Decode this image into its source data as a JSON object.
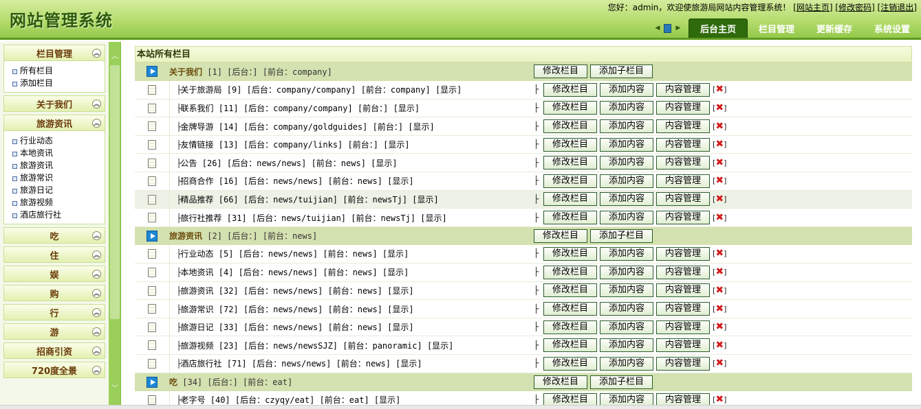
{
  "header": {
    "logo": "网站管理系统",
    "greeting": "您好：admin，欢迎使旅游局网站内容管理系统！",
    "links": [
      "[网站主页]",
      "[修改密码]",
      "[注销退出]"
    ],
    "tabs": [
      "后台主页",
      "栏目管理",
      "更新缓存",
      "系统设置"
    ],
    "active_tab": "后台主页"
  },
  "sidebar": {
    "sections": [
      {
        "title": "栏目管理",
        "items": [
          "所有栏目",
          "添加栏目"
        ]
      },
      {
        "title": "关于我们",
        "items": []
      },
      {
        "title": "旅游资讯",
        "items": [
          "行业动态",
          "本地资讯",
          "旅游资讯",
          "旅游常识",
          "旅游日记",
          "旅游视频",
          "酒店旅行社"
        ]
      },
      {
        "title": "吃",
        "items": []
      },
      {
        "title": "住",
        "items": []
      },
      {
        "title": "娱",
        "items": []
      },
      {
        "title": "购",
        "items": []
      },
      {
        "title": "行",
        "items": []
      },
      {
        "title": "游",
        "items": []
      },
      {
        "title": "招商引资",
        "items": []
      },
      {
        "title": "720度全景",
        "items": []
      }
    ]
  },
  "main": {
    "title": "本站所有栏目",
    "buttons": {
      "edit": "修改栏目",
      "add_child": "添加子栏目",
      "add_content": "添加内容",
      "manage_content": "内容管理",
      "delete_icon": "✖"
    },
    "rows": [
      {
        "type": "parent",
        "name": "关于我们",
        "meta": "[1] [后台：] [前台：company]"
      },
      {
        "type": "child",
        "name": "关于旅游局",
        "meta": "[9] [后台：company/company] [前台：company] [显示]"
      },
      {
        "type": "child",
        "name": "联系我们",
        "meta": "[11] [后台：company/company] [前台：] [显示]"
      },
      {
        "type": "child",
        "name": "金牌导游",
        "meta": "[14] [后台：company/goldguides] [前台：] [显示]"
      },
      {
        "type": "child",
        "name": "友情链接",
        "meta": "[13] [后台：company/links] [前台：] [显示]"
      },
      {
        "type": "child",
        "name": "公告",
        "meta": "[26] [后台：news/news] [前台：news] [显示]"
      },
      {
        "type": "child",
        "name": "招商合作",
        "meta": "[16] [后台：news/news] [前台：news] [显示]"
      },
      {
        "type": "child",
        "name": "精品推荐",
        "meta": "[66] [后台：news/tuijian] [前台：newsTj] [显示]",
        "highlight": true
      },
      {
        "type": "child",
        "name": "旅行社推荐",
        "meta": "[31] [后台：news/tuijian] [前台：newsTj] [显示]"
      },
      {
        "type": "parent",
        "name": "旅游资讯",
        "meta": "[2] [后台：] [前台：news]"
      },
      {
        "type": "child",
        "name": "行业动态",
        "meta": "[5] [后台：news/news] [前台：news] [显示]"
      },
      {
        "type": "child",
        "name": "本地资讯",
        "meta": "[4] [后台：news/news] [前台：news] [显示]"
      },
      {
        "type": "child",
        "name": "旅游资讯",
        "meta": "[32] [后台：news/news] [前台：news] [显示]"
      },
      {
        "type": "child",
        "name": "旅游常识",
        "meta": "[72] [后台：news/news] [前台：news] [显示]"
      },
      {
        "type": "child",
        "name": "旅游日记",
        "meta": "[33] [后台：news/news] [前台：news] [显示]"
      },
      {
        "type": "child",
        "name": "旅游视频",
        "meta": "[23] [后台：news/newsSJZ] [前台：panoramic] [显示]"
      },
      {
        "type": "child",
        "name": "酒店旅行社",
        "meta": "[71] [后台：news/news] [前台：news] [显示]"
      },
      {
        "type": "parent",
        "name": "吃",
        "meta": "[34] [后台：] [前台：eat]"
      },
      {
        "type": "child",
        "name": "老字号",
        "meta": "[40] [后台：czyqy/eat] [前台：eat] [显示]"
      }
    ]
  }
}
